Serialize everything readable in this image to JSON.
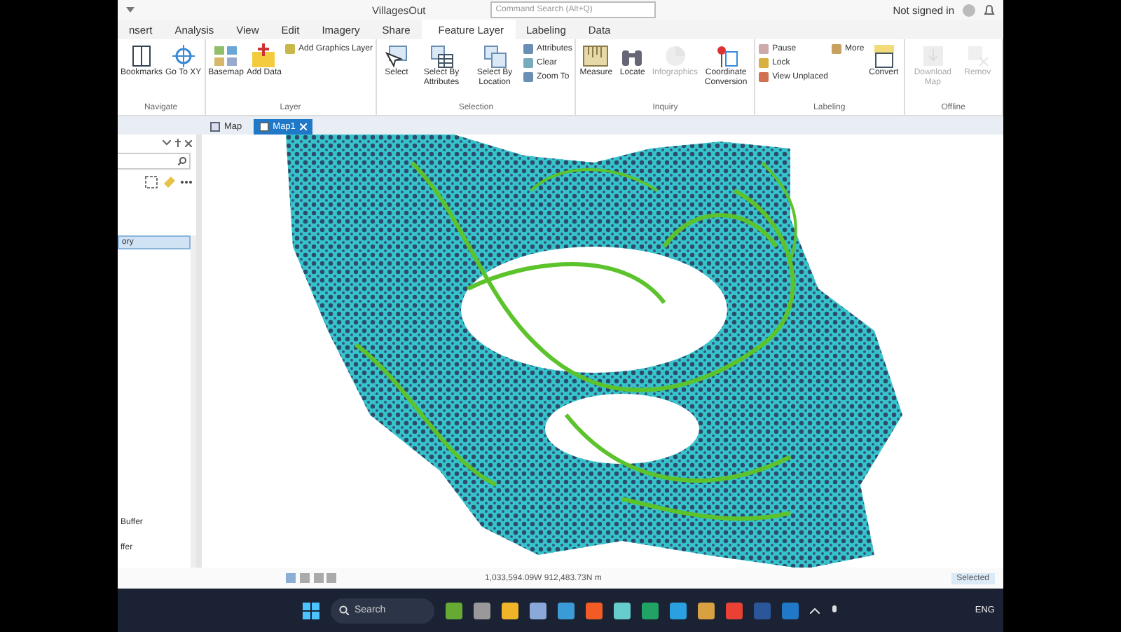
{
  "title_bar": {
    "project": "VillagesOut",
    "search_placeholder": "Command Search (Alt+Q)",
    "account": "Not signed in"
  },
  "ribbon_tabs": [
    {
      "label": "nsert",
      "kind": "tab"
    },
    {
      "label": "Analysis",
      "kind": "tab"
    },
    {
      "label": "View",
      "kind": "tab"
    },
    {
      "label": "Edit",
      "kind": "tab"
    },
    {
      "label": "Imagery",
      "kind": "tab"
    },
    {
      "label": "Share",
      "kind": "tab"
    },
    {
      "label": "Feature Layer",
      "kind": "context"
    },
    {
      "label": "Labeling",
      "kind": "tab"
    },
    {
      "label": "Data",
      "kind": "tab"
    }
  ],
  "ribbon_groups": [
    {
      "label": "Navigate",
      "buttons": [
        {
          "label": "Bookmarks",
          "kind": "large",
          "disabled": false
        },
        {
          "label": "Go To XY",
          "kind": "large",
          "disabled": false
        }
      ]
    },
    {
      "label": "Layer",
      "buttons": [
        {
          "label": "Basemap",
          "kind": "large",
          "disabled": false
        },
        {
          "label": "Add Data",
          "kind": "large",
          "disabled": false
        },
        {
          "label": "Add Graphics Layer",
          "kind": "small",
          "disabled": false
        }
      ]
    },
    {
      "label": "Selection",
      "buttons": [
        {
          "label": "Select",
          "kind": "large",
          "disabled": false
        },
        {
          "label": "Select By Attributes",
          "kind": "large",
          "disabled": false
        },
        {
          "label": "Select By Location",
          "kind": "large",
          "disabled": false
        },
        {
          "label": "Attributes",
          "kind": "small",
          "disabled": false
        },
        {
          "label": "Clear",
          "kind": "small",
          "disabled": false
        },
        {
          "label": "Zoom To",
          "kind": "small",
          "disabled": false
        }
      ]
    },
    {
      "label": "Inquiry",
      "buttons": [
        {
          "label": "Measure",
          "kind": "large",
          "disabled": false
        },
        {
          "label": "Locate",
          "kind": "large",
          "disabled": false
        },
        {
          "label": "Infographics",
          "kind": "large",
          "disabled": true
        },
        {
          "label": "Coordinate Conversion",
          "kind": "large",
          "disabled": false
        }
      ]
    },
    {
      "label": "Labeling",
      "buttons": [
        {
          "label": "Pause",
          "kind": "small",
          "disabled": false
        },
        {
          "label": "Lock",
          "kind": "small",
          "disabled": false
        },
        {
          "label": "View Unplaced",
          "kind": "small",
          "disabled": false
        },
        {
          "label": "More",
          "kind": "small",
          "disabled": false
        },
        {
          "label": "Convert",
          "kind": "large",
          "disabled": false
        }
      ]
    },
    {
      "label": "Offline",
      "buttons": [
        {
          "label": "Download Map",
          "kind": "large",
          "disabled": true
        },
        {
          "label": "Remov",
          "kind": "large",
          "disabled": true
        }
      ]
    }
  ],
  "doc_tabs": [
    {
      "label": "Map",
      "selected": false
    },
    {
      "label": "Map1",
      "selected": true
    }
  ],
  "pane": {
    "items": [
      {
        "label": "ory",
        "selected": true
      },
      {
        "label": "Buffer",
        "selected": false
      },
      {
        "label": "ffer",
        "selected": false
      }
    ]
  },
  "status_bar": {
    "coordinates": "1,033,594.09W 912,483.73N m",
    "selection": "Selected"
  },
  "taskbar": {
    "search": "Search",
    "language": "ENG"
  }
}
